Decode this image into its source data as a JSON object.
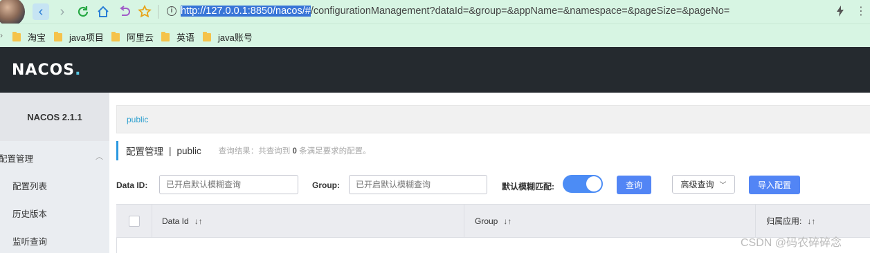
{
  "browser": {
    "url_highlighted": "http://127.0.0.1:8850/nacos/#",
    "url_rest": "/configurationManagement?dataId=&group=&appName=&namespace=&pageSize=&pageNo="
  },
  "bookmarks": [
    "淘宝",
    "java项目",
    "阿里云",
    "英语",
    "java账号"
  ],
  "header": {
    "logo_left": "NACOS",
    "logo_dot": "."
  },
  "sidebar": {
    "title": "NACOS 2.1.1",
    "group": "配置管理",
    "items": [
      "配置列表",
      "历史版本",
      "监听查询"
    ]
  },
  "namespace_bar": {
    "active": "public"
  },
  "page": {
    "title": "配置管理",
    "separator": "|",
    "namespace": "public",
    "result_prefix": "查询结果：共查询到",
    "result_count": "0",
    "result_suffix": "条满足要求的配置。"
  },
  "filters": {
    "data_id_label": "Data ID:",
    "data_id_placeholder": "已开启默认模糊查询",
    "group_label": "Group:",
    "group_placeholder": "已开启默认模糊查询",
    "fuzzy_label": "默认模糊匹配:",
    "fuzzy_on": true,
    "query_button": "查询",
    "advanced_button": "高级查询",
    "import_button": "导入配置"
  },
  "table": {
    "columns": [
      "Data Id",
      "Group",
      "归属应用:"
    ]
  },
  "watermark": "CSDN @码农碎碎念",
  "colors": {
    "accent": "#5285f5",
    "header_bg": "#252a2f",
    "browser_bg": "#d7f5e3"
  }
}
